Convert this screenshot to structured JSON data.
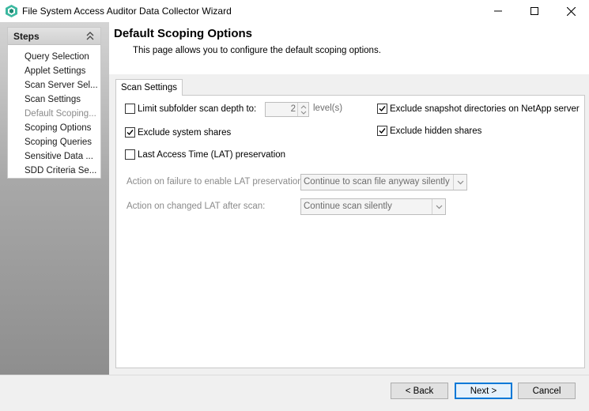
{
  "window": {
    "title": "File System Access Auditor Data Collector Wizard"
  },
  "sidebar": {
    "header": "Steps",
    "items": [
      {
        "label": "Query Selection"
      },
      {
        "label": "Applet Settings"
      },
      {
        "label": "Scan Server Sel..."
      },
      {
        "label": "Scan Settings"
      },
      {
        "label": "Default Scoping..."
      },
      {
        "label": "Scoping Options"
      },
      {
        "label": "Scoping Queries"
      },
      {
        "label": "Sensitive Data ..."
      },
      {
        "label": "SDD Criteria Se..."
      }
    ],
    "current_index": 4
  },
  "page": {
    "title": "Default Scoping Options",
    "description": "This page allows you to configure the default scoping options."
  },
  "tab": {
    "label": "Scan Settings"
  },
  "options": {
    "limit_subfolder": {
      "label": "Limit subfolder scan depth to:",
      "checked": false
    },
    "depth_value": "2",
    "depth_unit": "level(s)",
    "exclude_system_shares": {
      "label": "Exclude system shares",
      "checked": true
    },
    "lat_preservation": {
      "label": "Last Access Time (LAT) preservation",
      "checked": false
    },
    "exclude_snapshot": {
      "label": "Exclude snapshot directories on NetApp server",
      "checked": true
    },
    "exclude_hidden": {
      "label": "Exclude hidden shares",
      "checked": true
    }
  },
  "lat_failure": {
    "label": "Action on failure to enable LAT preservation:",
    "value": "Continue to scan file anyway silently"
  },
  "lat_changed": {
    "label": "Action on changed LAT after scan:",
    "value": "Continue scan silently"
  },
  "footer": {
    "back": "< Back",
    "next": "Next >",
    "cancel": "Cancel"
  },
  "colors": {
    "accent": "#0078d7",
    "app_icon": "#3cb8a0"
  }
}
